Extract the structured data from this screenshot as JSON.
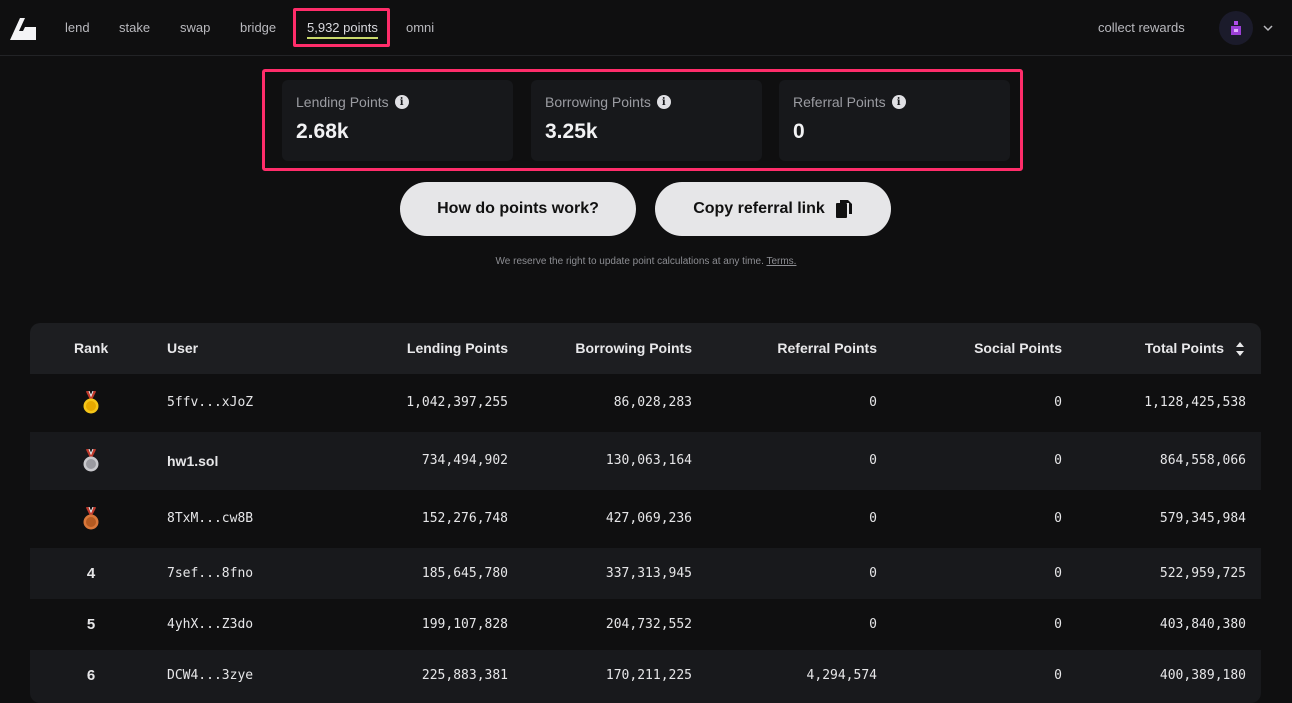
{
  "nav": {
    "links": [
      "lend",
      "stake",
      "swap",
      "bridge",
      "5,932 points",
      "omni"
    ],
    "collect": "collect rewards",
    "accent": "#c9d96a",
    "highlight": "#ff2d6a"
  },
  "cards": [
    {
      "label": "Lending Points",
      "value": "2.68k"
    },
    {
      "label": "Borrowing Points",
      "value": "3.25k"
    },
    {
      "label": "Referral Points",
      "value": "0"
    }
  ],
  "buttons": {
    "how": "How do points work?",
    "copy": "Copy referral link"
  },
  "disclaimer": {
    "text": "We reserve the right to update point calculations at any time.",
    "terms": "Terms."
  },
  "table": {
    "headers": [
      "Rank",
      "User",
      "Lending Points",
      "Borrowing Points",
      "Referral Points",
      "Social Points",
      "Total Points"
    ],
    "rows": [
      {
        "rank": "1",
        "medal": "gold-medal-icon",
        "user": "5ffv...xJoZ",
        "lending": "1,042,397,255",
        "borrowing": "86,028,283",
        "referral": "0",
        "social": "0",
        "total": "1,128,425,538"
      },
      {
        "rank": "2",
        "medal": "silver-medal-icon",
        "user": "hw1.sol",
        "lending": "734,494,902",
        "borrowing": "130,063,164",
        "referral": "0",
        "social": "0",
        "total": "864,558,066"
      },
      {
        "rank": "3",
        "medal": "bronze-medal-icon",
        "user": "8TxM...cw8B",
        "lending": "152,276,748",
        "borrowing": "427,069,236",
        "referral": "0",
        "social": "0",
        "total": "579,345,984"
      },
      {
        "rank": "4",
        "user": "7sef...8fno",
        "lending": "185,645,780",
        "borrowing": "337,313,945",
        "referral": "0",
        "social": "0",
        "total": "522,959,725"
      },
      {
        "rank": "5",
        "user": "4yhX...Z3do",
        "lending": "199,107,828",
        "borrowing": "204,732,552",
        "referral": "0",
        "social": "0",
        "total": "403,840,380"
      },
      {
        "rank": "6",
        "user": "DCW4...3zye",
        "lending": "225,883,381",
        "borrowing": "170,211,225",
        "referral": "4,294,574",
        "social": "0",
        "total": "400,389,180"
      }
    ]
  }
}
